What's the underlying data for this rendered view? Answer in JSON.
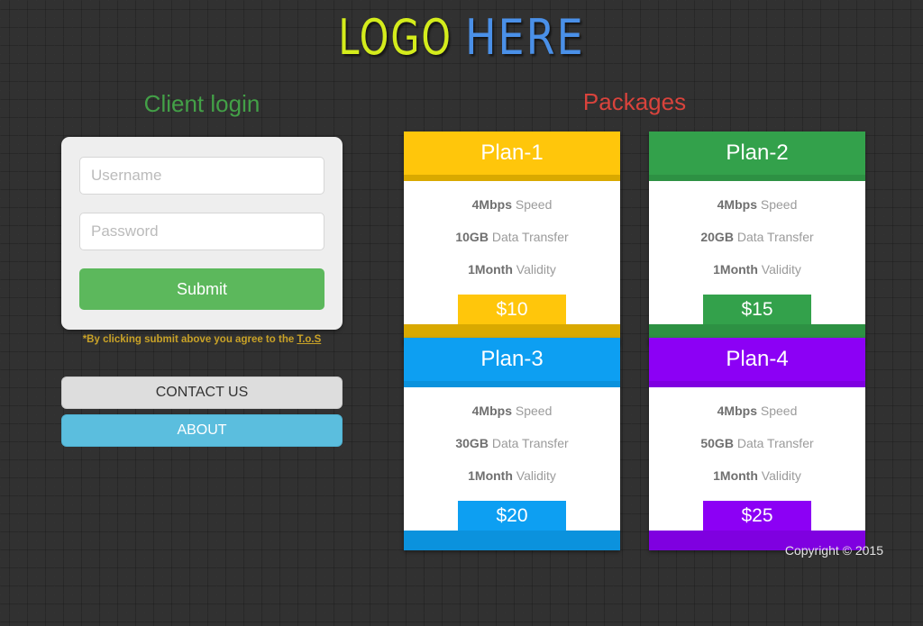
{
  "logo": {
    "part1": "LOGO",
    "part2": "HERE",
    "color1": "#d4ec1c",
    "color2": "#4a90e8"
  },
  "login": {
    "heading": "Client login",
    "heading_color": "#43a047",
    "username_placeholder": "Username",
    "username_value": "",
    "password_placeholder": "Password",
    "password_value": "",
    "submit_label": "Submit",
    "submit_color": "#5cb85c",
    "tos_text": "*By clicking submit above you agree to the ",
    "tos_link_label": "T.o.S",
    "tos_color": "#c9a227"
  },
  "side_buttons": [
    {
      "label": "CONTACT US",
      "color": "#dddddd",
      "text_color": "#333333"
    },
    {
      "label": "ABOUT",
      "color": "#5bbede",
      "text_color": "#ffffff"
    }
  ],
  "packages": {
    "heading": "Packages",
    "heading_color": "#d9433c",
    "cards": [
      {
        "title": "Plan-1",
        "color": "#ffc60b",
        "dark_color": "#d9a900",
        "features": [
          {
            "value": "4Mbps",
            "label": " Speed"
          },
          {
            "value": "10GB",
            "label": " Data Transfer"
          },
          {
            "value": "1Month",
            "label": " Validity"
          }
        ],
        "price": "$10"
      },
      {
        "title": "Plan-2",
        "color": "#33a14b",
        "dark_color": "#2d9143",
        "features": [
          {
            "value": "4Mbps",
            "label": " Speed"
          },
          {
            "value": "20GB",
            "label": " Data Transfer"
          },
          {
            "value": "1Month",
            "label": " Validity"
          }
        ],
        "price": "$15"
      },
      {
        "title": "Plan-3",
        "color": "#0d9ff2",
        "dark_color": "#0b92dd",
        "features": [
          {
            "value": "4Mbps",
            "label": " Speed"
          },
          {
            "value": "30GB",
            "label": " Data Transfer"
          },
          {
            "value": "1Month",
            "label": " Validity"
          }
        ],
        "price": "$20"
      },
      {
        "title": "Plan-4",
        "color": "#8c00f5",
        "dark_color": "#7f00e0",
        "features": [
          {
            "value": "4Mbps",
            "label": " Speed"
          },
          {
            "value": "50GB",
            "label": " Data Transfer"
          },
          {
            "value": "1Month",
            "label": " Validity"
          }
        ],
        "price": "$25"
      }
    ]
  },
  "footer": {
    "copyright": "Copyright © 2015"
  }
}
